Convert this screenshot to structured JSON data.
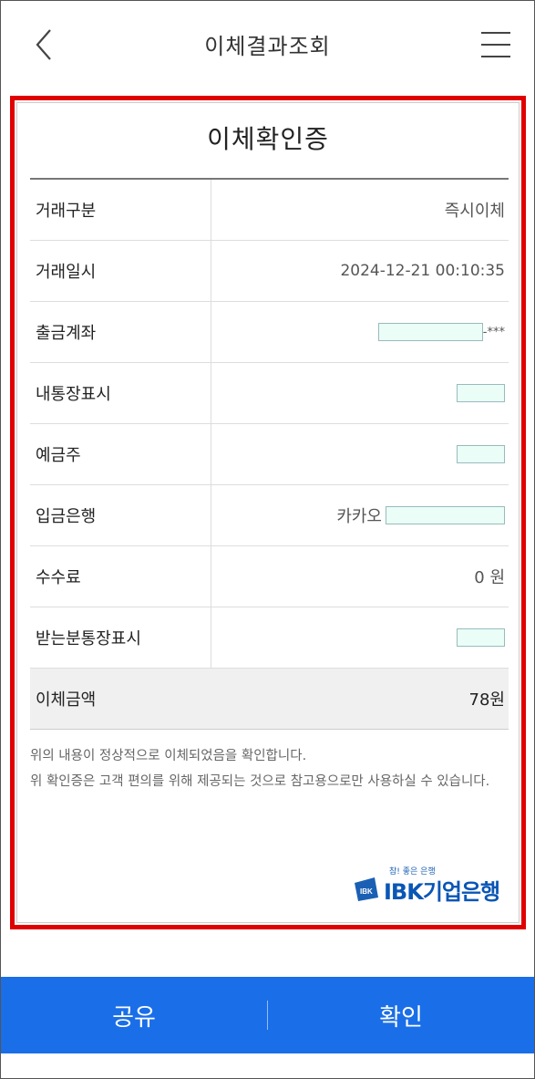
{
  "header": {
    "title": "이체결과조회",
    "back_icon": "chevron-left-icon",
    "menu_icon": "hamburger-menu-icon"
  },
  "receipt": {
    "title": "이체확인증",
    "rows": [
      {
        "label": "거래구분",
        "value": "즉시이체"
      },
      {
        "label": "거래일시",
        "value": "2024-12-21 00:10:35"
      },
      {
        "label": "출금계좌",
        "value_suffix": "-***"
      },
      {
        "label": "내통장표시",
        "value": ""
      },
      {
        "label": "예금주",
        "value": ""
      },
      {
        "label": "입금은행",
        "value_prefix": "카카오"
      },
      {
        "label": "수수료",
        "value": "0 원"
      },
      {
        "label": "받는분통장표시",
        "value": ""
      }
    ],
    "total": {
      "label": "이체금액",
      "value": "78원"
    },
    "notice_line1": "위의 내용이 정상적으로 이체되었음을 확인합니다.",
    "notice_line2": "위 확인증은 고객 편의를 위해 제공되는 것으로 참고용으로만 사용하실 수 있습니다."
  },
  "logo": {
    "tagline": "참! 좋은 은행",
    "name": "IBK기업은행"
  },
  "footer": {
    "share_label": "공유",
    "confirm_label": "확인"
  },
  "colors": {
    "highlight": "#e00000",
    "primary": "#1a6ee8",
    "brand": "#0a56b5",
    "redaction": "#eafdf7"
  }
}
